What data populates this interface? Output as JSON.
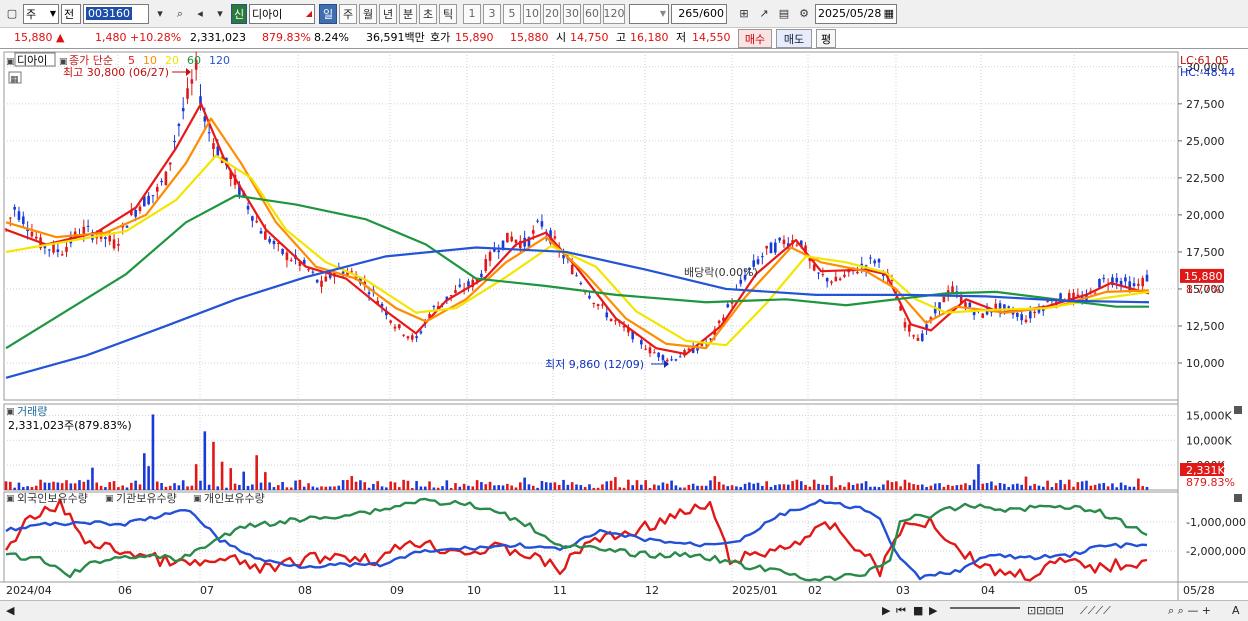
{
  "toolbar": {
    "type_label": "주",
    "period_label": "전",
    "stock_code": "003160",
    "stock_name": "디아이",
    "badge_label": "신",
    "intervals": [
      "일",
      "주",
      "월",
      "년",
      "분",
      "초",
      "틱"
    ],
    "active_interval": "일",
    "tick_numbers": [
      "1",
      "3",
      "5",
      "10",
      "20",
      "30",
      "60",
      "120"
    ],
    "count": "265",
    "count_total": "/600",
    "date": "2025/05/28"
  },
  "quote": {
    "price": "15,880",
    "change": "1,480",
    "change_rate": "+10.28%",
    "volume": "2,331,023",
    "volume_ratio": "879.83%",
    "turnover": "8.24%",
    "amount": "36,591백만",
    "ask_label": "호가",
    "ask": "15,890",
    "bid": "15,880",
    "open_label": "시",
    "open": "14,750",
    "high_label": "고",
    "high": "16,180",
    "low_label": "저",
    "low": "14,550",
    "buy_label": "매수",
    "sell_label": "매도",
    "eval_label": "평"
  },
  "chart_data": {
    "type": "candlestick",
    "stock_tag": "디아이",
    "ma_label": "종가 단순",
    "ma_periods": [
      "5",
      "10",
      "20",
      "60",
      "120"
    ],
    "ma_colors": [
      "#e81818",
      "#ff8c00",
      "#f2e600",
      "#1e9640",
      "#2454d6"
    ],
    "high_annotation": "최고 30,800 (06/27)",
    "low_annotation": "최저 9,860 (12/09)",
    "dividend_annotation": "배당락(0.00%)",
    "lc": "LC:61.05",
    "hc": "HC:-48.44",
    "y_ticks": [
      "30,000",
      "27,500",
      "25,000",
      "22,500",
      "20,000",
      "17,500",
      "15,000",
      "12,500",
      "10,000"
    ],
    "y_values": [
      30000,
      27500,
      25000,
      22500,
      20000,
      17500,
      15000,
      12500,
      10000
    ],
    "ylim": [
      7500,
      31000
    ],
    "price_tag": "15,880",
    "price_pct_tag": "8.77%",
    "price_series": [
      [
        0,
        19000
      ],
      [
        8,
        20500
      ],
      [
        20,
        19500
      ],
      [
        35,
        18000
      ],
      [
        55,
        17500
      ],
      [
        75,
        19000
      ],
      [
        95,
        18600
      ],
      [
        110,
        18000
      ],
      [
        120,
        19500
      ],
      [
        135,
        20800
      ],
      [
        150,
        21500
      ],
      [
        160,
        22500
      ],
      [
        170,
        25500
      ],
      [
        182,
        28000
      ],
      [
        190,
        29800
      ],
      [
        200,
        26000
      ],
      [
        215,
        24000
      ],
      [
        235,
        21500
      ],
      [
        255,
        19000
      ],
      [
        275,
        17500
      ],
      [
        300,
        16500
      ],
      [
        315,
        15200
      ],
      [
        330,
        16300
      ],
      [
        350,
        16000
      ],
      [
        370,
        14500
      ],
      [
        390,
        12500
      ],
      [
        410,
        11500
      ],
      [
        425,
        13500
      ],
      [
        450,
        14800
      ],
      [
        470,
        15500
      ],
      [
        490,
        17800
      ],
      [
        505,
        18500
      ],
      [
        520,
        18000
      ],
      [
        535,
        19500
      ],
      [
        550,
        18000
      ],
      [
        565,
        16500
      ],
      [
        585,
        14500
      ],
      [
        605,
        13000
      ],
      [
        625,
        12000
      ],
      [
        645,
        10800
      ],
      [
        665,
        10200
      ],
      [
        690,
        11000
      ],
      [
        705,
        11500
      ],
      [
        720,
        13500
      ],
      [
        740,
        16000
      ],
      [
        760,
        17500
      ],
      [
        780,
        18300
      ],
      [
        795,
        18200
      ],
      [
        810,
        16000
      ],
      [
        830,
        15500
      ],
      [
        850,
        16300
      ],
      [
        870,
        17000
      ],
      [
        885,
        15500
      ],
      [
        900,
        12500
      ],
      [
        915,
        11600
      ],
      [
        930,
        13500
      ],
      [
        945,
        15000
      ],
      [
        960,
        14000
      ],
      [
        975,
        13200
      ],
      [
        990,
        13800
      ],
      [
        1005,
        13500
      ],
      [
        1020,
        13000
      ],
      [
        1040,
        14000
      ],
      [
        1060,
        14500
      ],
      [
        1080,
        14300
      ],
      [
        1095,
        15500
      ],
      [
        1110,
        15700
      ],
      [
        1130,
        15100
      ],
      [
        1143,
        15880
      ]
    ],
    "ma_series": {
      "ma5": [
        [
          0,
          19000
        ],
        [
          40,
          18000
        ],
        [
          90,
          18800
        ],
        [
          130,
          20500
        ],
        [
          170,
          24500
        ],
        [
          195,
          27500
        ],
        [
          220,
          23500
        ],
        [
          260,
          19000
        ],
        [
          300,
          16500
        ],
        [
          340,
          15700
        ],
        [
          380,
          13500
        ],
        [
          410,
          12000
        ],
        [
          440,
          14200
        ],
        [
          480,
          15800
        ],
        [
          510,
          18000
        ],
        [
          540,
          18800
        ],
        [
          570,
          16500
        ],
        [
          610,
          13000
        ],
        [
          650,
          11000
        ],
        [
          680,
          10600
        ],
        [
          715,
          12500
        ],
        [
          750,
          16000
        ],
        [
          790,
          18300
        ],
        [
          815,
          16200
        ],
        [
          860,
          16300
        ],
        [
          880,
          16000
        ],
        [
          905,
          12600
        ],
        [
          925,
          12200
        ],
        [
          960,
          14300
        ],
        [
          995,
          13400
        ],
        [
          1040,
          13800
        ],
        [
          1080,
          14600
        ],
        [
          1105,
          15400
        ],
        [
          1143,
          14700
        ]
      ],
      "ma10": [
        [
          0,
          19500
        ],
        [
          50,
          18500
        ],
        [
          100,
          18800
        ],
        [
          140,
          20000
        ],
        [
          180,
          23500
        ],
        [
          205,
          26500
        ],
        [
          235,
          23500
        ],
        [
          270,
          19500
        ],
        [
          310,
          16500
        ],
        [
          350,
          15700
        ],
        [
          390,
          13700
        ],
        [
          420,
          12800
        ],
        [
          460,
          14300
        ],
        [
          500,
          16800
        ],
        [
          540,
          18500
        ],
        [
          580,
          16000
        ],
        [
          620,
          13000
        ],
        [
          660,
          11300
        ],
        [
          700,
          11000
        ],
        [
          740,
          14500
        ],
        [
          785,
          17800
        ],
        [
          815,
          16800
        ],
        [
          860,
          16200
        ],
        [
          890,
          15000
        ],
        [
          920,
          12700
        ],
        [
          950,
          13800
        ],
        [
          1000,
          13400
        ],
        [
          1050,
          13800
        ],
        [
          1100,
          14800
        ],
        [
          1143,
          14900
        ]
      ],
      "ma20": [
        [
          0,
          17500
        ],
        [
          60,
          18200
        ],
        [
          120,
          18900
        ],
        [
          170,
          21000
        ],
        [
          210,
          24000
        ],
        [
          245,
          22500
        ],
        [
          280,
          19000
        ],
        [
          320,
          16800
        ],
        [
          360,
          15600
        ],
        [
          410,
          13400
        ],
        [
          450,
          13700
        ],
        [
          500,
          15800
        ],
        [
          545,
          17900
        ],
        [
          590,
          16500
        ],
        [
          630,
          13500
        ],
        [
          680,
          11500
        ],
        [
          720,
          11200
        ],
        [
          760,
          14000
        ],
        [
          800,
          17200
        ],
        [
          840,
          16800
        ],
        [
          880,
          16100
        ],
        [
          910,
          14300
        ],
        [
          940,
          13400
        ],
        [
          990,
          13600
        ],
        [
          1040,
          13700
        ],
        [
          1100,
          14400
        ],
        [
          1143,
          14800
        ]
      ],
      "ma60": [
        [
          0,
          11000
        ],
        [
          60,
          13500
        ],
        [
          120,
          16000
        ],
        [
          180,
          19500
        ],
        [
          230,
          21300
        ],
        [
          290,
          20700
        ],
        [
          360,
          19700
        ],
        [
          420,
          18000
        ],
        [
          470,
          15700
        ],
        [
          540,
          15200
        ],
        [
          610,
          14600
        ],
        [
          700,
          14100
        ],
        [
          780,
          14300
        ],
        [
          840,
          13900
        ],
        [
          890,
          14300
        ],
        [
          940,
          14700
        ],
        [
          990,
          14800
        ],
        [
          1050,
          14300
        ],
        [
          1110,
          13800
        ],
        [
          1143,
          13800
        ]
      ],
      "ma120": [
        [
          0,
          9000
        ],
        [
          80,
          10500
        ],
        [
          160,
          12500
        ],
        [
          230,
          14300
        ],
        [
          300,
          15800
        ],
        [
          380,
          17200
        ],
        [
          470,
          17800
        ],
        [
          560,
          17500
        ],
        [
          640,
          16300
        ],
        [
          720,
          15000
        ],
        [
          810,
          14600
        ],
        [
          900,
          14600
        ],
        [
          980,
          14500
        ],
        [
          1060,
          14200
        ],
        [
          1143,
          14100
        ]
      ]
    },
    "volume_panel": {
      "title": "거래량",
      "readout": "2,331,023주(879.83%)",
      "y_ticks": [
        "15,000K",
        "10,000K",
        "5,000K"
      ],
      "y_values": [
        15000,
        10000,
        5000
      ],
      "last_tag": "2,331K",
      "last_pct": "879.83%"
    },
    "holdings_panel": {
      "series_names": [
        "외국인보유수량",
        "기관보유수량",
        "개인보유수량"
      ],
      "series_colors": [
        "#e01818",
        "#2450d6",
        "#2a8a4a"
      ],
      "y_ticks": [
        "-1,000,000",
        "-2,000,000"
      ]
    },
    "x_labels": [
      "2024/04",
      "06",
      "07",
      "08",
      "09",
      "10",
      "11",
      "12",
      "2025/01",
      "02",
      "03",
      "04",
      "05",
      "05/28"
    ]
  }
}
